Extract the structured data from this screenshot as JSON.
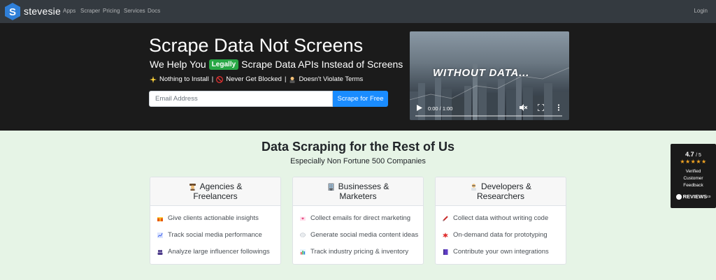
{
  "navbar": {
    "brand": "stevesie",
    "links": [
      "Apps",
      "Scraper",
      "Pricing",
      "Services",
      "Docs"
    ],
    "login": "Login"
  },
  "hero": {
    "title": "Scrape Data Not Screens",
    "subtitle_before": "We Help You",
    "subtitle_badge": "Legally",
    "subtitle_after": "Scrape Data APIs Instead of Screens",
    "features": [
      "Nothing to Install",
      "Never Get Blocked",
      "Doesn't Violate Terms"
    ],
    "separator": "|",
    "email_placeholder": "Email Address",
    "cta": "Scrape for Free",
    "video": {
      "overlay": "WITHOUT DATA...",
      "time": "0:00 / 1:00"
    }
  },
  "section": {
    "title": "Data Scraping for the Rest of Us",
    "subtitle": "Especially Non Fortune 500 Companies"
  },
  "cards": [
    {
      "header_line1": "Agencies &",
      "header_line2": "Freelancers",
      "icon": "detective-icon",
      "items": [
        {
          "icon": "gift-icon",
          "text": "Give clients actionable insights"
        },
        {
          "icon": "chart-up-icon",
          "text": "Track social media performance"
        },
        {
          "icon": "people-icon",
          "text": "Analyze large influencer followings"
        }
      ]
    },
    {
      "header_line1": "Businesses &",
      "header_line2": "Marketers",
      "icon": "office-building-icon",
      "items": [
        {
          "icon": "love-letter-icon",
          "text": "Collect emails for direct marketing"
        },
        {
          "icon": "speech-bubble-icon",
          "text": "Generate social media content ideas"
        },
        {
          "icon": "bar-chart-icon",
          "text": "Track industry pricing & inventory"
        }
      ]
    },
    {
      "header_line1": "Developers &",
      "header_line2": "Researchers",
      "icon": "scientist-icon",
      "items": [
        {
          "icon": "syringe-icon",
          "text": "Collect data without writing code"
        },
        {
          "icon": "explosion-icon",
          "text": "On-demand data for prototyping"
        },
        {
          "icon": "notebook-icon",
          "text": "Contribute your own integrations"
        }
      ]
    }
  ],
  "reviews": {
    "rating": "4.7",
    "out_of": "/ 5",
    "stars": "★★★★★",
    "line1": "Verified",
    "line2": "Customer",
    "line3": "Feedback",
    "brand": "REVIEWS",
    "brand_suffix": "co"
  },
  "colors": {
    "nav_bg": "#343a40",
    "hero_bg": "#1b1b1b",
    "section_bg": "#e6f4e6",
    "badge_green": "#28a745",
    "cta_blue": "#1a8cff",
    "star_orange": "#f5a623"
  }
}
